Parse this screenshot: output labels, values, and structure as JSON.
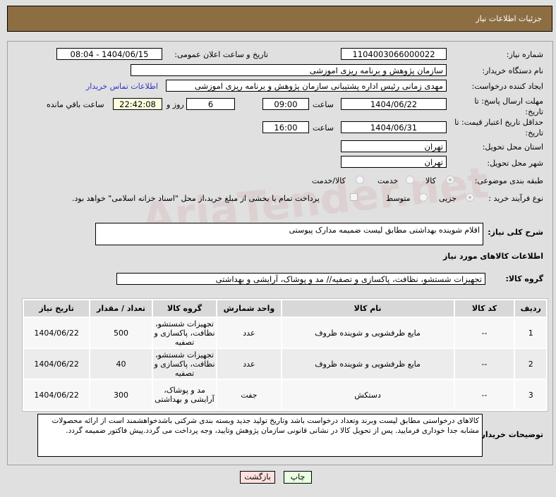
{
  "header": {
    "title": "جزئیات اطلاعات نیاز"
  },
  "form": {
    "need_number_label": "شماره نیاز:",
    "need_number": "1104003066000022",
    "announce_label": "تاریخ و ساعت اعلان عمومی:",
    "announce_value": "1404/06/15 - 08:04",
    "buyer_label": "نام دستگاه خریدار:",
    "buyer_value": "سازمان پژوهش و برنامه ریزی اموزشی",
    "creator_label": "ایجاد کننده درخواست:",
    "creator_value": "مهدی زمانی رئیس اداره پشتیبانی سازمان پژوهش و برنامه ریزی اموزشی",
    "contact_link": "اطلاعات تماس خریدار",
    "deadline_label": "مهلت ارسال پاسخ: تا تاریخ:",
    "deadline_date": "1404/06/22",
    "time_label": "ساعت",
    "deadline_time": "09:00",
    "days": "6",
    "days_label": "روز و",
    "remaining": "22:42:08",
    "remaining_label": "ساعت باقي مانده",
    "validity_label": "حداقل تاریخ اعتبار قیمت: تا تاریخ:",
    "validity_date": "1404/06/31",
    "validity_time": "16:00",
    "province_label": "استان محل تحویل:",
    "province": "تهران",
    "city_label": "شهر محل تحویل:",
    "city": "تهران",
    "category_label": "طبقه بندی موضوعی:",
    "category_options": [
      "کالا",
      "خدمت",
      "کالا/خدمت"
    ],
    "purchase_label": "نوع فرآیند خرید :",
    "purchase_options": [
      "جزیی",
      "متوسط"
    ],
    "payment_note": "پرداخت تمام یا بخشی از مبلغ خرید،از محل \"اسناد خزانه اسلامی\" خواهد بود."
  },
  "description": {
    "label": "شرح کلی نیاز:",
    "value": "اقلام شوینده بهداشتی مطابق لیست ضمیمه مدارک پیوستی"
  },
  "goods": {
    "title": "اطلاعات کالاهای مورد نیاز",
    "group_label": "گروه کالا:",
    "group_value": "تجهیزات شستشو، نظافت، پاکسازی و تصفیه// مد و پوشاک، آرایشی و بهداشتی",
    "columns": [
      "ردیف",
      "کد کالا",
      "نام کالا",
      "واحد شمارش",
      "گروه کالا",
      "تعداد / مقدار",
      "تاریخ نیاز"
    ],
    "rows": [
      [
        "1",
        "--",
        "مایع ظرفشویی و شوینده ظروف",
        "عدد",
        "تجهیزات شستشو، نظافت، پاکسازی و تصفیه",
        "500",
        "1404/06/22"
      ],
      [
        "2",
        "--",
        "مایع ظرفشویی و شوینده ظروف",
        "عدد",
        "تجهیزات شستشو، نظافت، پاکسازی و تصفیه",
        "40",
        "1404/06/22"
      ],
      [
        "3",
        "--",
        "دستکش",
        "جفت",
        "مد و پوشاک، آرایشی و بهداشتی",
        "300",
        "1404/06/22"
      ]
    ]
  },
  "notes": {
    "label": "توضیحات خریدار:",
    "value": "کالاهای درخواستی مطابق لیست وبرند وتعداد درخواست باشد وتاریخ تولید جدید وبسته بندی شرکتی باشدخواهشمند است از ارائه محصولات مشابه جدا خوداری فرمایید. پس از تحویل کالا در نشانی قانونی سازمان پژوهش وتایید، وجه پرداخت می گردد.پیش فاکتور ضمیمه گردد."
  },
  "buttons": {
    "print": "چاپ",
    "back": "بازگشت"
  },
  "watermark": "AriaTender.net"
}
